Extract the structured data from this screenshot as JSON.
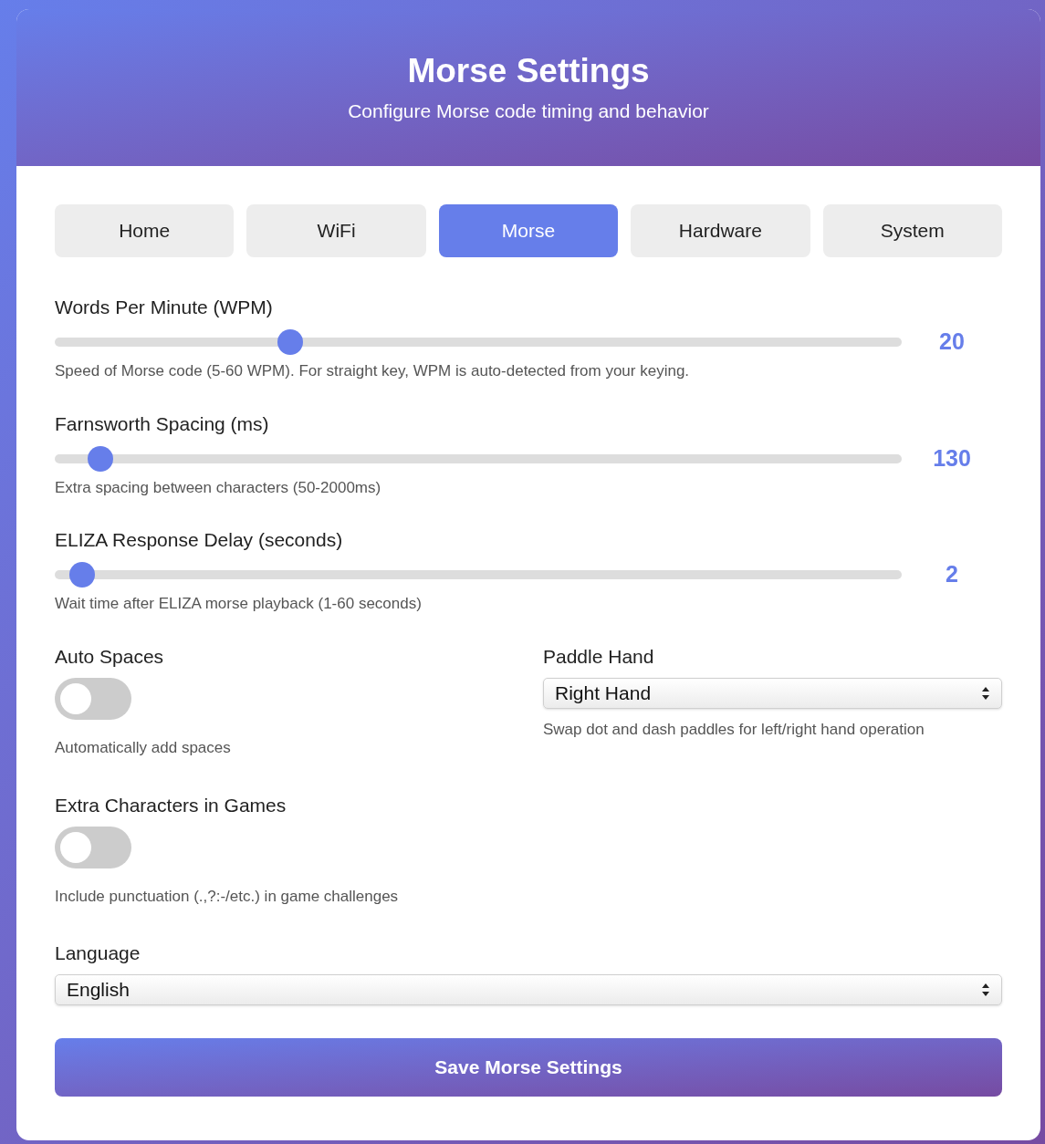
{
  "header": {
    "title": "Morse Settings",
    "subtitle": "Configure Morse code timing and behavior"
  },
  "tabs": [
    {
      "label": "Home",
      "selected": false
    },
    {
      "label": "WiFi",
      "selected": false
    },
    {
      "label": "Morse",
      "selected": true
    },
    {
      "label": "Hardware",
      "selected": false
    },
    {
      "label": "System",
      "selected": false
    }
  ],
  "sliders": [
    {
      "label": "Words Per Minute (WPM)",
      "level": 0.278,
      "reading": "20",
      "description": "Speed of Morse code (5-60 WPM). For straight key, WPM is auto-detected from your keying."
    },
    {
      "label": "Farnsworth Spacing (ms)",
      "level": 0.054,
      "reading": "130",
      "description": "Extra spacing between characters (50-2000ms)"
    },
    {
      "label": "ELIZA Response Delay (seconds)",
      "level": 0.032,
      "reading": "2",
      "description": "Wait time after ELIZA morse playback (1-60 seconds)"
    }
  ],
  "auto_spaces": {
    "label": "Auto Spaces",
    "on": false,
    "description": "Automatically add spaces"
  },
  "paddle_hand": {
    "label": "Paddle Hand",
    "value": "Right Hand",
    "description": "Swap dot and dash paddles for left/right hand operation"
  },
  "extra_characters": {
    "label": "Extra Characters in Games",
    "on": false,
    "description": "Include punctuation (.,?:-/etc.) in game challenges"
  },
  "language": {
    "label": "Language",
    "value": "English"
  },
  "save_button": "Save Morse Settings"
}
